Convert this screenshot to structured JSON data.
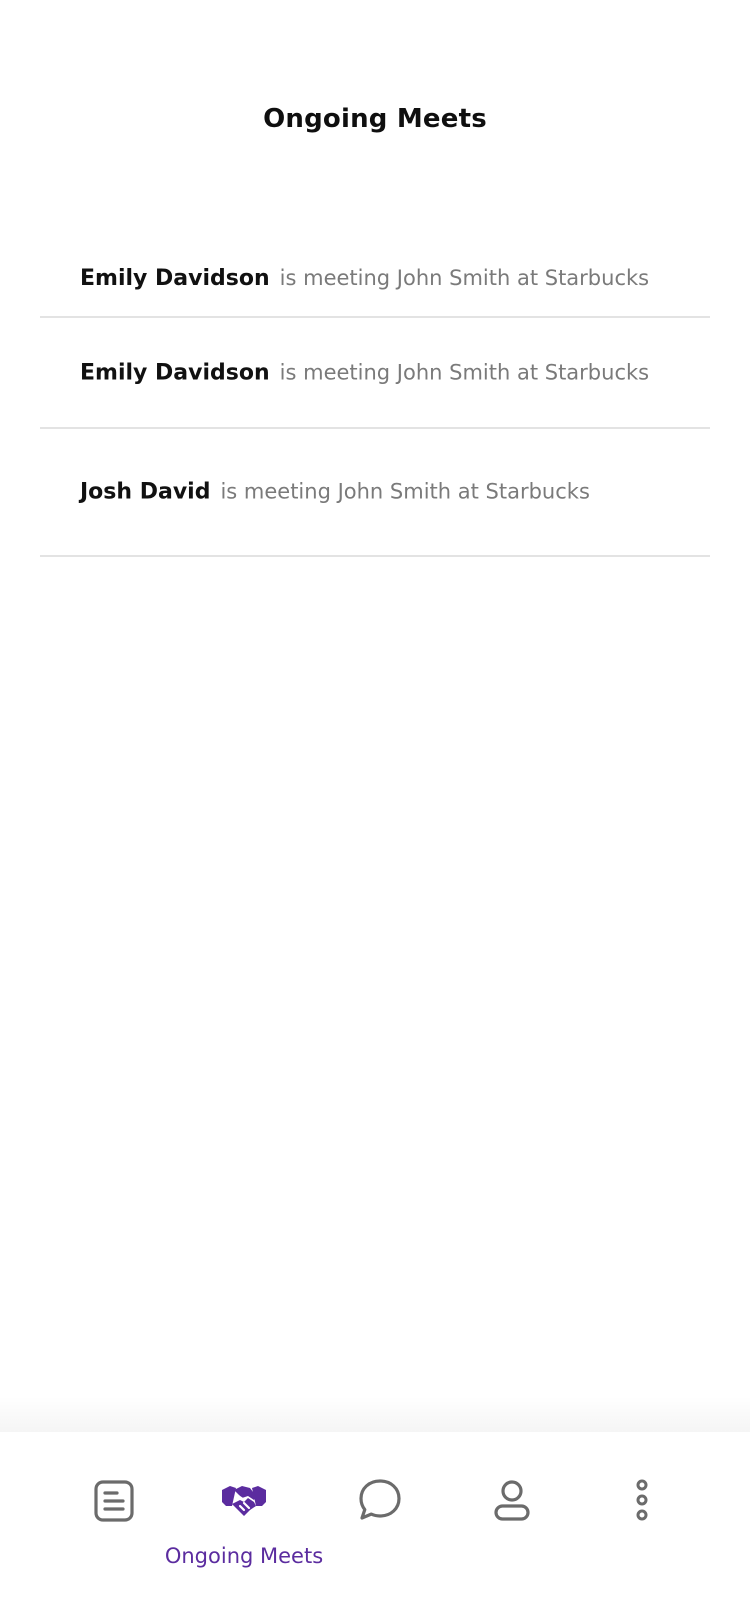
{
  "header": {
    "title": "Ongoing Meets"
  },
  "meets": [
    {
      "name": "Emily Davidson",
      "description": "is meeting John Smith at Starbucks"
    },
    {
      "name": "Emily Davidson",
      "description": "is meeting John Smith at Starbucks"
    },
    {
      "name": "Josh David",
      "description": "is meeting John Smith at Starbucks"
    }
  ],
  "bottom_nav": {
    "active_label": "Ongoing Meets",
    "items": [
      {
        "icon": "document-icon",
        "active": false
      },
      {
        "icon": "handshake-icon",
        "active": true
      },
      {
        "icon": "chat-bubble-icon",
        "active": false
      },
      {
        "icon": "user-icon",
        "active": false
      },
      {
        "icon": "more-vertical-icon",
        "active": false
      }
    ]
  },
  "colors": {
    "accent": "#5b2c9f",
    "icon_inactive": "#6b6b6b",
    "divider": "#e3e3e3",
    "secondary_text": "#7a7a7a"
  }
}
